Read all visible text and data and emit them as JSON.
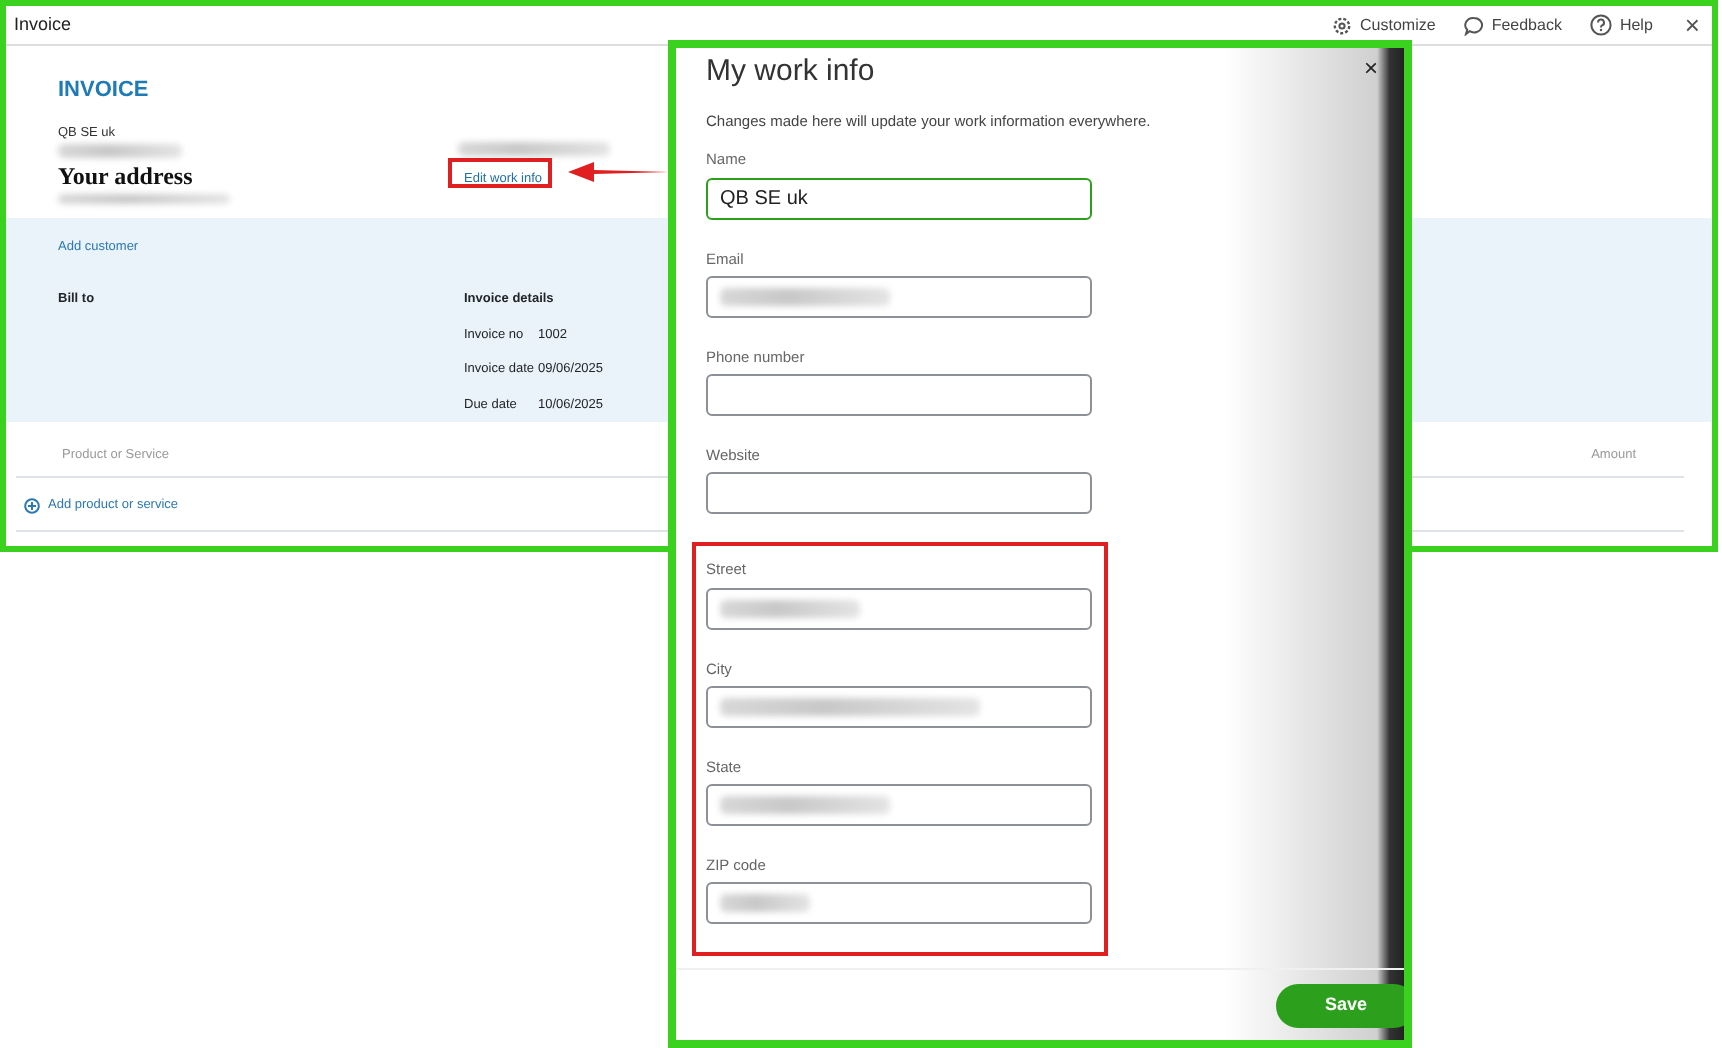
{
  "window": {
    "title": "Invoice",
    "close": "×",
    "toolbar": [
      {
        "kind": "gear",
        "label": "Customize"
      },
      {
        "kind": "chat",
        "label": "Feedback"
      },
      {
        "kind": "help",
        "label": "Help"
      }
    ]
  },
  "invoice": {
    "heading": "INVOICE",
    "company": "QB SE uk",
    "address_label": "Your address",
    "edit_link": "Edit work info",
    "add_customer": "Add customer",
    "bill_to": "Bill to",
    "details_title": "Invoice details",
    "details": [
      {
        "label": "Invoice no",
        "value": "1002"
      },
      {
        "label": "Invoice date",
        "value": "09/06/2025"
      },
      {
        "label": "Due date",
        "value": "10/06/2025"
      }
    ],
    "columns": [
      "Product or Service",
      "Amount"
    ],
    "add_line": "Add product or service"
  },
  "panel": {
    "title": "My work info",
    "close": "×",
    "intro": "Changes made here will update your work information everywhere.",
    "fields": [
      {
        "label": "Name",
        "value": "QB SE uk",
        "focused": true,
        "redacted": false,
        "highlighted": false
      },
      {
        "label": "Email",
        "focused": false,
        "redacted": true,
        "highlighted": false
      },
      {
        "label": "Phone number",
        "focused": false,
        "redacted": false,
        "highlighted": false
      },
      {
        "label": "Website",
        "focused": false,
        "redacted": false,
        "highlighted": false
      },
      {
        "label": "Street",
        "focused": false,
        "redacted": true,
        "highlighted": true
      },
      {
        "label": "City",
        "focused": false,
        "redacted": true,
        "highlighted": true
      },
      {
        "label": "State",
        "focused": false,
        "redacted": true,
        "highlighted": true
      },
      {
        "label": "ZIP code",
        "focused": false,
        "redacted": true,
        "highlighted": true
      }
    ],
    "save": "Save"
  }
}
